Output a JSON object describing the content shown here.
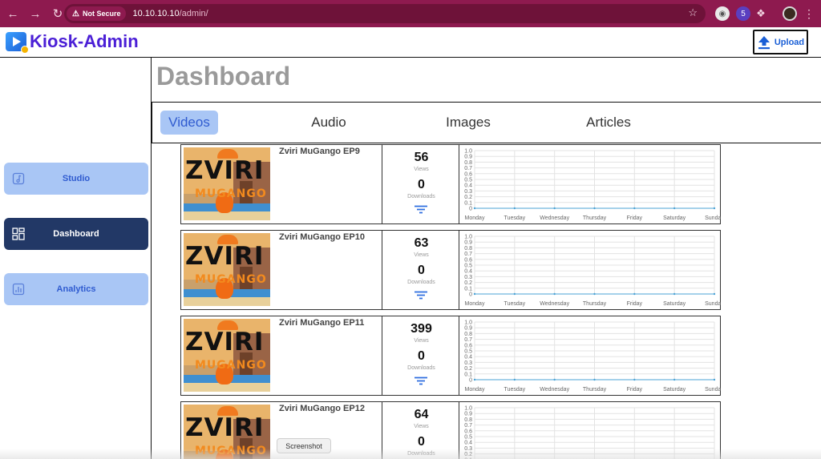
{
  "browser": {
    "security_label": "Not Secure",
    "url_host": "10.10.10.10",
    "url_path": "/admin/",
    "extension_badge": "5"
  },
  "header": {
    "app_title": "Kiosk-Admin",
    "upload_label": "Upload"
  },
  "sidebar": {
    "items": [
      {
        "label": "Studio",
        "icon": "music-note-icon"
      },
      {
        "label": "Dashboard",
        "icon": "dashboard-grid-icon"
      },
      {
        "label": "Analytics",
        "icon": "bar-chart-icon"
      }
    ]
  },
  "main": {
    "title": "Dashboard",
    "tabs": [
      {
        "label": "Videos",
        "active": true
      },
      {
        "label": "Audio",
        "active": false
      },
      {
        "label": "Images",
        "active": false
      },
      {
        "label": "Articles",
        "active": false
      }
    ]
  },
  "cards": [
    {
      "title": "Zviri MuGango EP9",
      "views": "56",
      "views_label": "Views",
      "downloads": "0",
      "downloads_label": "Downloads",
      "thumb_line1": "ZVIRI",
      "thumb_line2": "MUGANGO"
    },
    {
      "title": "Zviri MuGango EP10",
      "views": "63",
      "views_label": "Views",
      "downloads": "0",
      "downloads_label": "Downloads",
      "thumb_line1": "ZVIRI",
      "thumb_line2": "MUGANGO"
    },
    {
      "title": "Zviri MuGango EP11",
      "views": "399",
      "views_label": "Views",
      "downloads": "0",
      "downloads_label": "Downloads",
      "thumb_line1": "ZVIRI",
      "thumb_line2": "MUGANGO"
    },
    {
      "title": "Zviri MuGango EP12",
      "views": "64",
      "views_label": "Views",
      "downloads": "0",
      "downloads_label": "Downloads",
      "thumb_line1": "ZVIRI",
      "thumb_line2": "MUGANGO"
    }
  ],
  "chart_data": {
    "type": "line",
    "categories": [
      "Monday",
      "Tuesday",
      "Wednesday",
      "Thursday",
      "Friday",
      "Saturday",
      "Sunday"
    ],
    "y_ticks": [
      "1.0",
      "0.9",
      "0.8",
      "0.7",
      "0.6",
      "0.5",
      "0.4",
      "0.3",
      "0.2",
      "0.1",
      "0"
    ],
    "ylim": [
      0,
      1.0
    ],
    "grid": true,
    "series": [
      {
        "values": [
          0,
          0,
          0,
          0,
          0,
          0,
          0
        ]
      }
    ],
    "line_color": "#4ba3d6"
  },
  "tooltip": "Screenshot"
}
